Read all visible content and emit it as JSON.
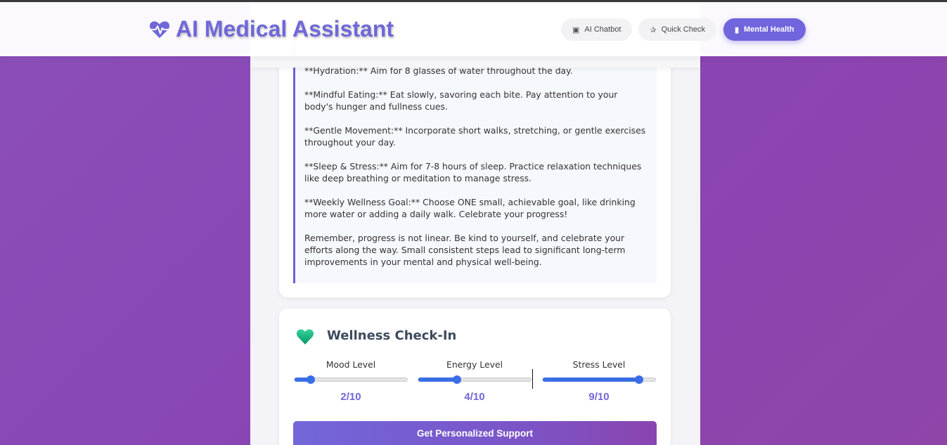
{
  "header": {
    "title": "AI Medical Assistant",
    "nav": [
      {
        "label": "AI Chatbot",
        "icon": "robot-icon"
      },
      {
        "label": "Quick Check",
        "icon": "stethoscope-icon"
      },
      {
        "label": "Mental Health",
        "icon": "brain-icon",
        "active": true
      }
    ]
  },
  "advice": {
    "paragraphs": [
      "**Hydration:** Aim for 8 glasses of water throughout the day.",
      "**Mindful Eating:**  Eat slowly, savoring each bite. Pay attention to your body's hunger and fullness cues.",
      "**Gentle Movement:**  Incorporate short walks, stretching, or gentle exercises throughout your day.",
      "**Sleep & Stress:** Aim for 7-8 hours of sleep. Practice relaxation techniques like deep breathing or meditation to manage stress.",
      "**Weekly Wellness Goal:**  Choose ONE small, achievable goal, like drinking more water or adding a daily walk. Celebrate your progress!",
      "Remember, progress is not linear. Be kind to yourself, and celebrate your efforts along the way.  Small consistent steps lead to significant long-term improvements in your mental and physical well-being."
    ]
  },
  "wellness": {
    "title": "Wellness Check-In",
    "sliders": [
      {
        "label": "Mood Level",
        "value": 2,
        "max": 10,
        "display": "2/10"
      },
      {
        "label": "Energy Level",
        "value": 4,
        "max": 10,
        "display": "4/10"
      },
      {
        "label": "Stress Level",
        "value": 9,
        "max": 10,
        "display": "9/10"
      }
    ],
    "submit_label": "Get Personalized Support"
  },
  "colors": {
    "accent": "#6f68d8",
    "slider": "#3a6ee6",
    "heart": "#10b981"
  }
}
